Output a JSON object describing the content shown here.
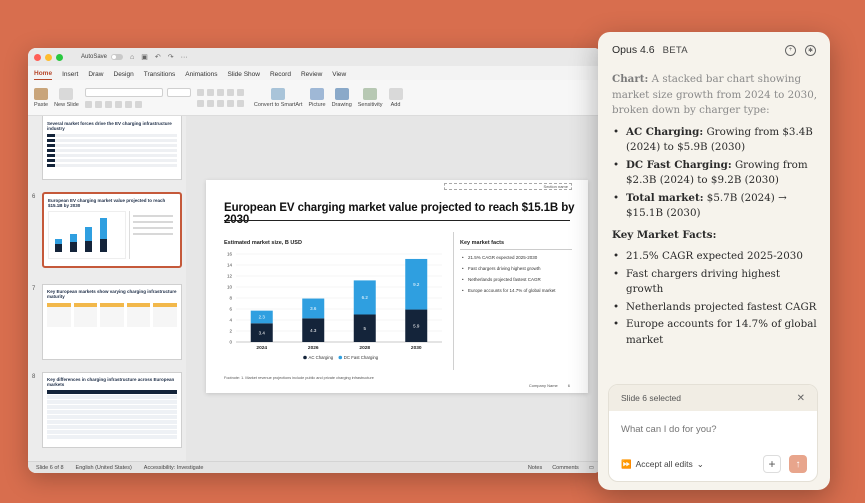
{
  "app": {
    "autosave_label": "AutoSave",
    "tabs": [
      "Home",
      "Insert",
      "Draw",
      "Design",
      "Transitions",
      "Animations",
      "Slide Show",
      "Record",
      "Review",
      "View"
    ],
    "ribbon": {
      "paste": "Paste",
      "new_slide": "New\nSlide",
      "convert_smartart": "Convert to\nSmartArt",
      "picture": "Picture",
      "drawing": "Drawing",
      "sensitivity": "Sensitivity",
      "add_ins": "Add"
    }
  },
  "thumbnails": [
    {
      "num": "",
      "title": "Several market forces drive the EV charging infrastructure industry"
    },
    {
      "num": "6",
      "title": "European EV charging market value projected to reach $15.1B by 2030"
    },
    {
      "num": "7",
      "title": "Key European markets show varying charging infrastructure maturity"
    },
    {
      "num": "8",
      "title": "Key differences in charging infrastructure across European markets"
    }
  ],
  "slide": {
    "section_tag": "Section name",
    "title": "European EV charging market value projected to reach $15.1B by 2030",
    "chart_label": "Estimated market size, B USD",
    "facts_title": "Key market facts",
    "facts": [
      "21.5% CAGR expected 2025-2030",
      "Fast chargers driving highest growth",
      "Netherlands projected fastest CAGR",
      "Europe accounts for 14.7% of global market"
    ],
    "footnote": "Footnote: 1. Market revenue projections include public and private charging infrastructure",
    "company": "Company Name",
    "page": "6"
  },
  "chart_data": {
    "type": "bar",
    "stacked": true,
    "categories": [
      "2024",
      "2026",
      "2028",
      "2030"
    ],
    "series": [
      {
        "name": "AC Charging",
        "values": [
          3.4,
          4.3,
          5.0,
          5.9
        ],
        "color": "#14243a"
      },
      {
        "name": "DC Fast Charging",
        "values": [
          2.3,
          3.6,
          6.2,
          9.2
        ],
        "color": "#2f9fe0"
      }
    ],
    "y_ticks": [
      "0",
      "2",
      "4",
      "6",
      "8",
      "10",
      "12",
      "14",
      "16"
    ],
    "ylim": [
      0,
      16
    ],
    "grid": true,
    "legend": "bottom"
  },
  "statusbar": {
    "slide_info": "Slide 6 of 8",
    "language": "English (United States)",
    "accessibility": "Accessibility: Investigate",
    "notes": "Notes",
    "comments": "Comments"
  },
  "panel": {
    "model": "Opus 4.6",
    "badge": "BETA",
    "intro_label": "Chart:",
    "intro_text": "A stacked bar chart showing market size growth from 2024 to 2030, broken down by charger type:",
    "bullets": [
      {
        "label": "AC Charging:",
        "text": "Growing from $3.4B (2024) to $5.9B (2030)"
      },
      {
        "label": "DC Fast Charging:",
        "text": "Growing from $2.3B (2024) to $9.2B (2030)"
      },
      {
        "label": "Total market:",
        "text": "$5.7B (2024) → $15.1B (2030)"
      }
    ],
    "facts_heading": "Key Market Facts:",
    "facts": [
      "21.5% CAGR expected 2025-2030",
      "Fast chargers driving highest growth",
      "Netherlands projected fastest CAGR",
      "Europe accounts for 14.7% of global market"
    ],
    "selection": "Slide 6 selected",
    "input_placeholder": "What can I do for you?",
    "accept_label": "Accept all edits"
  }
}
